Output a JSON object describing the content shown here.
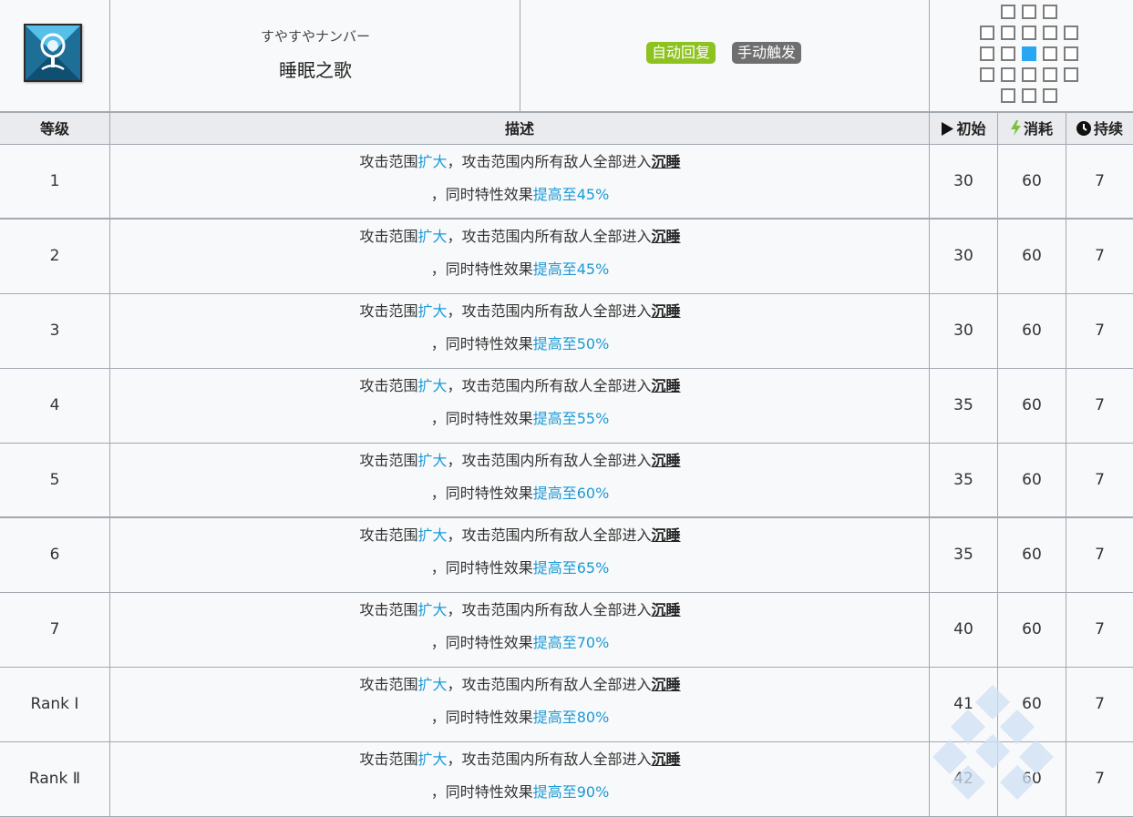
{
  "skill": {
    "icon": "skill-icon",
    "subtitle": "すやすやナンバー",
    "name": "睡眠之歌",
    "tags": {
      "auto": "自动回复",
      "manual": "手动触发"
    },
    "tag_colors": {
      "auto": "#8ec31f",
      "manual": "#6f6f6f"
    },
    "range_active_color": "#27a6f3"
  },
  "table": {
    "headers": {
      "level": "等级",
      "desc": "描述",
      "init": "初始",
      "cost": "消耗",
      "dur": "持续"
    },
    "header_icons": {
      "init": "play-icon",
      "cost": "lightning-icon",
      "dur": "clock-icon"
    },
    "rows": [
      {
        "level": "1",
        "d1": "攻击范围",
        "d2": "扩大",
        "d3": "，攻击范围内所有敌人全部进入",
        "d4": "沉睡",
        "d5": "，同时特性效果",
        "d6": "提高至45%",
        "init": "30",
        "cost": "60",
        "dur": "7"
      },
      {
        "level": "2",
        "d1": "攻击范围",
        "d2": "扩大",
        "d3": "，攻击范围内所有敌人全部进入",
        "d4": "沉睡",
        "d5": "，同时特性效果",
        "d6": "提高至45%",
        "init": "30",
        "cost": "60",
        "dur": "7"
      },
      {
        "level": "3",
        "d1": "攻击范围",
        "d2": "扩大",
        "d3": "，攻击范围内所有敌人全部进入",
        "d4": "沉睡",
        "d5": "，同时特性效果",
        "d6": "提高至50%",
        "init": "30",
        "cost": "60",
        "dur": "7"
      },
      {
        "level": "4",
        "d1": "攻击范围",
        "d2": "扩大",
        "d3": "，攻击范围内所有敌人全部进入",
        "d4": "沉睡",
        "d5": "，同时特性效果",
        "d6": "提高至55%",
        "init": "35",
        "cost": "60",
        "dur": "7"
      },
      {
        "level": "5",
        "d1": "攻击范围",
        "d2": "扩大",
        "d3": "，攻击范围内所有敌人全部进入",
        "d4": "沉睡",
        "d5": "，同时特性效果",
        "d6": "提高至60%",
        "init": "35",
        "cost": "60",
        "dur": "7"
      },
      {
        "level": "6",
        "d1": "攻击范围",
        "d2": "扩大",
        "d3": "，攻击范围内所有敌人全部进入",
        "d4": "沉睡",
        "d5": "，同时特性效果",
        "d6": "提高至65%",
        "init": "35",
        "cost": "60",
        "dur": "7"
      },
      {
        "level": "7",
        "d1": "攻击范围",
        "d2": "扩大",
        "d3": "，攻击范围内所有敌人全部进入",
        "d4": "沉睡",
        "d5": "，同时特性效果",
        "d6": "提高至70%",
        "init": "40",
        "cost": "60",
        "dur": "7"
      },
      {
        "level": "Rank Ⅰ",
        "d1": "攻击范围",
        "d2": "扩大",
        "d3": "，攻击范围内所有敌人全部进入",
        "d4": "沉睡",
        "d5": "，同时特性效果",
        "d6": "提高至80%",
        "init": "41",
        "cost": "60",
        "dur": "7"
      },
      {
        "level": "Rank Ⅱ",
        "d1": "攻击范围",
        "d2": "扩大",
        "d3": "，攻击范围内所有敌人全部进入",
        "d4": "沉睡",
        "d5": "，同时特性效果",
        "d6": "提高至90%",
        "init": "42",
        "cost": "60",
        "dur": "7"
      }
    ]
  }
}
